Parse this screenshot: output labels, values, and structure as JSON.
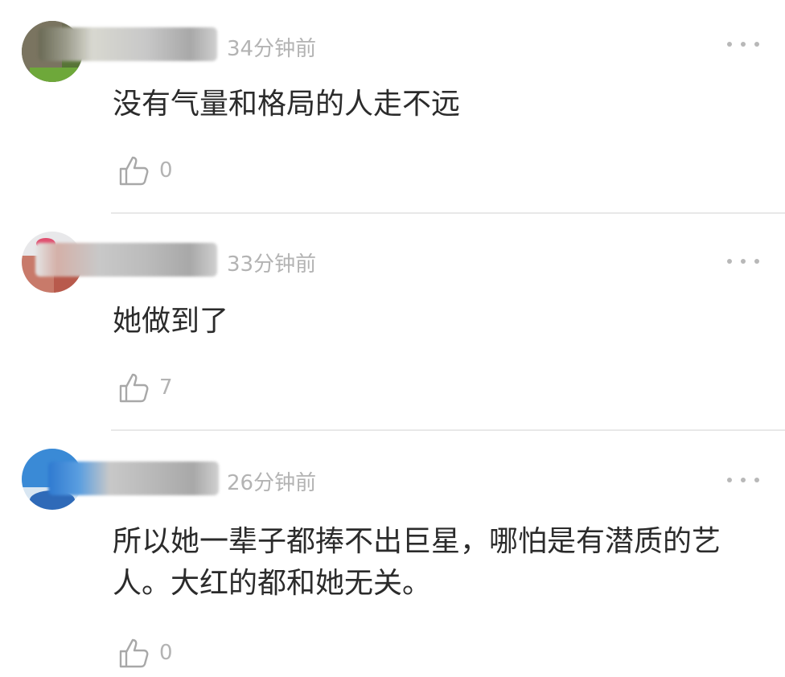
{
  "comments": [
    {
      "time": "34分钟前",
      "text": "没有气量和格局的人走不远",
      "likes": "0"
    },
    {
      "time": "33分钟前",
      "text": "她做到了",
      "likes": "7"
    },
    {
      "time": "26分钟前",
      "text": "所以她一辈子都捧不出巨星，哪怕是有潜质的艺人。大红的都和她无关。",
      "likes": "0"
    }
  ],
  "icons": {
    "like": "thumbs-up-icon",
    "more": "more-dots-icon"
  }
}
